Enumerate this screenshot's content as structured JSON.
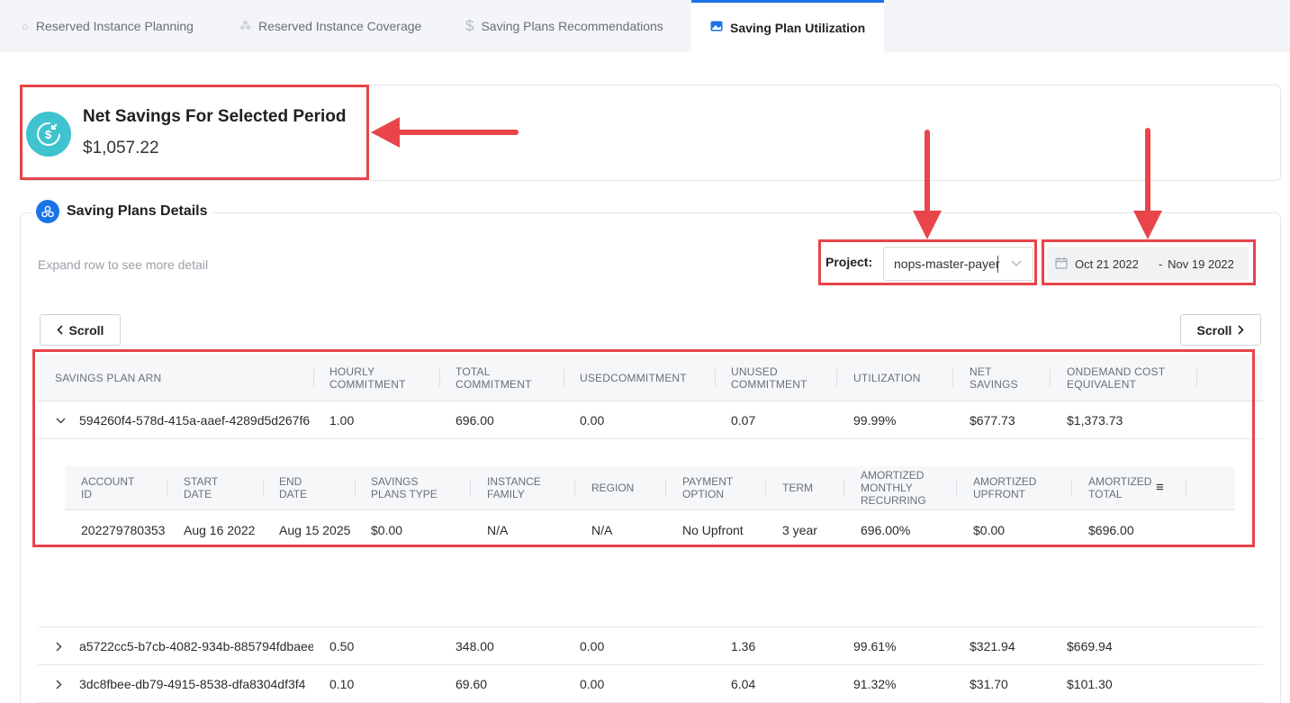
{
  "tabs": [
    {
      "label": "Reserved Instance Planning",
      "icon": "circle-icon"
    },
    {
      "label": "Reserved Instance Coverage",
      "icon": "cubes-icon"
    },
    {
      "label": "Saving Plans Recommendations",
      "icon": "dollar-icon"
    },
    {
      "label": "Saving Plan Utilization",
      "icon": "image-icon",
      "active": true
    }
  ],
  "net_savings": {
    "title": "Net Savings For Selected Period",
    "value": "$1,057.22"
  },
  "details": {
    "title": "Saving Plans Details",
    "hint": "Expand row to see more detail",
    "project_label": "Project:",
    "project_value": "nops-master-payer",
    "date_start": "Oct 21 2022",
    "date_sep": "-",
    "date_end": "Nov 19 2022",
    "scroll_left": "Scroll",
    "scroll_right": "Scroll"
  },
  "table": {
    "headers": [
      "SAVINGS PLAN ARN",
      "HOURLY COMMITMENT",
      "TOTAL COMMITMENT",
      "USEDCOMMITMENT",
      "UNUSED COMMITMENT",
      "UTILIZATION",
      "NET SAVINGS",
      "ONDEMAND COST EQUIVALENT"
    ],
    "rows": [
      {
        "arn": "594260f4-578d-415a-aaef-4289d5d267f6",
        "hourly": "1.00",
        "total": "696.00",
        "used": "0.00",
        "unused": "0.07",
        "utilization": "99.99%",
        "net": "$677.73",
        "ondemand": "$1,373.73",
        "expanded": true
      },
      {
        "arn": "a5722cc5-b7cb-4082-934b-885794fdbaee",
        "hourly": "0.50",
        "total": "348.00",
        "used": "0.00",
        "unused": "1.36",
        "utilization": "99.61%",
        "net": "$321.94",
        "ondemand": "$669.94",
        "expanded": false
      },
      {
        "arn": "3dc8fbee-db79-4915-8538-dfa8304df3f4",
        "hourly": "0.10",
        "total": "69.60",
        "used": "0.00",
        "unused": "6.04",
        "utilization": "91.32%",
        "net": "$31.70",
        "ondemand": "$101.30",
        "expanded": false
      }
    ]
  },
  "sub_table": {
    "headers": [
      "ACCOUNT ID",
      "START DATE",
      "END DATE",
      "SAVINGS PLANS TYPE",
      "INSTANCE FAMILY",
      "REGION",
      "PAYMENT OPTION",
      "TERM",
      "AMORTIZED MONTHLY RECURRING",
      "AMORTIZED UPFRONT",
      "AMORTIZED TOTAL"
    ],
    "row": [
      "202279780353",
      "Aug 16 2022",
      "Aug 15 2025",
      "$0.00",
      "N/A",
      "N/A",
      "No Upfront",
      "3 year",
      "696.00%",
      "$0.00",
      "$696.00"
    ]
  },
  "colors": {
    "accent": "#1a73e8",
    "annotation": "#e8444a",
    "net_icon": "#3fc3cf"
  }
}
